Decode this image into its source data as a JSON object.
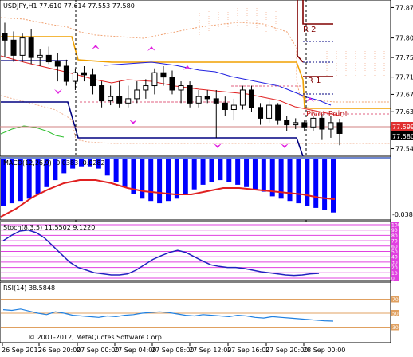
{
  "window": {
    "main_header": "USDJPY,H1  77.610 77.614 77.553 77.580",
    "macd_header": "MACD(12,26,9) -0.0383 -0.0282",
    "stoch_header": "Stoch(8,3,5) 11.5502 9.1220",
    "rsi_header": "RSI(14) 38.5848",
    "copyright": "© 2001-2012, MetaQuotes Software Corp."
  },
  "main_chart": {
    "price_axis": [
      "77.870",
      "77.800",
      "77.755",
      "77.710",
      "77.670",
      "77.630",
      "77.585",
      "77.545"
    ],
    "price_range": [
      77.535,
      77.88
    ],
    "bid_label": "77.599",
    "last_label": "77.580",
    "pivot_labels": [
      "R 2",
      "R 1",
      "Pivot Point"
    ],
    "pivot_levels": {
      "R 2": 77.8,
      "R 1": 77.71,
      "Pivot Point": 77.64
    },
    "candles": [
      {
        "o": 77.81,
        "h": 77.835,
        "l": 77.755,
        "c": 77.795
      },
      {
        "o": 77.795,
        "h": 77.815,
        "l": 77.745,
        "c": 77.76
      },
      {
        "o": 77.76,
        "h": 77.81,
        "l": 77.745,
        "c": 77.8
      },
      {
        "o": 77.8,
        "h": 77.82,
        "l": 77.74,
        "c": 77.755
      },
      {
        "o": 77.755,
        "h": 77.775,
        "l": 77.735,
        "c": 77.76
      },
      {
        "o": 77.76,
        "h": 77.78,
        "l": 77.74,
        "c": 77.745
      },
      {
        "o": 77.745,
        "h": 77.765,
        "l": 77.7,
        "c": 77.735
      },
      {
        "o": 77.735,
        "h": 77.75,
        "l": 77.69,
        "c": 77.7
      },
      {
        "o": 77.7,
        "h": 77.73,
        "l": 77.68,
        "c": 77.72
      },
      {
        "o": 77.72,
        "h": 77.735,
        "l": 77.7,
        "c": 77.715
      },
      {
        "o": 77.715,
        "h": 77.73,
        "l": 77.67,
        "c": 77.69
      },
      {
        "o": 77.69,
        "h": 77.7,
        "l": 77.64,
        "c": 77.655
      },
      {
        "o": 77.655,
        "h": 77.69,
        "l": 77.645,
        "c": 77.665
      },
      {
        "o": 77.665,
        "h": 77.7,
        "l": 77.64,
        "c": 77.65
      },
      {
        "o": 77.65,
        "h": 77.69,
        "l": 77.64,
        "c": 77.66
      },
      {
        "o": 77.66,
        "h": 77.7,
        "l": 77.65,
        "c": 77.68
      },
      {
        "o": 77.68,
        "h": 77.705,
        "l": 77.66,
        "c": 77.69
      },
      {
        "o": 77.69,
        "h": 77.73,
        "l": 77.67,
        "c": 77.72
      },
      {
        "o": 77.72,
        "h": 77.735,
        "l": 77.69,
        "c": 77.71
      },
      {
        "o": 77.71,
        "h": 77.725,
        "l": 77.67,
        "c": 77.68
      },
      {
        "o": 77.68,
        "h": 77.7,
        "l": 77.65,
        "c": 77.69
      },
      {
        "o": 77.69,
        "h": 77.7,
        "l": 77.64,
        "c": 77.65
      },
      {
        "o": 77.65,
        "h": 77.68,
        "l": 77.64,
        "c": 77.665
      },
      {
        "o": 77.665,
        "h": 77.68,
        "l": 77.65,
        "c": 77.66
      },
      {
        "o": 77.66,
        "h": 77.68,
        "l": 77.57,
        "c": 77.65
      },
      {
        "o": 77.65,
        "h": 77.665,
        "l": 77.62,
        "c": 77.635
      },
      {
        "o": 77.635,
        "h": 77.66,
        "l": 77.61,
        "c": 77.645
      },
      {
        "o": 77.645,
        "h": 77.69,
        "l": 77.635,
        "c": 77.68
      },
      {
        "o": 77.68,
        "h": 77.69,
        "l": 77.63,
        "c": 77.64
      },
      {
        "o": 77.64,
        "h": 77.65,
        "l": 77.6,
        "c": 77.615
      },
      {
        "o": 77.615,
        "h": 77.655,
        "l": 77.605,
        "c": 77.645
      },
      {
        "o": 77.645,
        "h": 77.65,
        "l": 77.6,
        "c": 77.61
      },
      {
        "o": 77.61,
        "h": 77.62,
        "l": 77.585,
        "c": 77.6
      },
      {
        "o": 77.6,
        "h": 77.615,
        "l": 77.59,
        "c": 77.605
      },
      {
        "o": 77.605,
        "h": 77.61,
        "l": 77.585,
        "c": 77.595
      },
      {
        "o": 77.595,
        "h": 77.62,
        "l": 77.585,
        "c": 77.615
      },
      {
        "o": 77.615,
        "h": 77.625,
        "l": 77.565,
        "c": 77.59
      },
      {
        "o": 77.59,
        "h": 77.62,
        "l": 77.57,
        "c": 77.605
      },
      {
        "o": 77.605,
        "h": 77.614,
        "l": 77.553,
        "c": 77.58
      }
    ]
  },
  "macd": {
    "axis_labels": [
      "-0.0383"
    ],
    "bars": [
      -0.1,
      -0.095,
      -0.09,
      -0.085,
      -0.075,
      -0.06,
      -0.045,
      -0.03,
      -0.02,
      -0.015,
      -0.015,
      -0.02,
      -0.035,
      -0.05,
      -0.06,
      -0.075,
      -0.085,
      -0.09,
      -0.095,
      -0.09,
      -0.085,
      -0.075,
      -0.065,
      -0.055,
      -0.05,
      -0.045,
      -0.05,
      -0.055,
      -0.06,
      -0.065,
      -0.07,
      -0.08,
      -0.085,
      -0.09,
      -0.095,
      -0.1,
      -0.105,
      -0.11,
      -0.115
    ]
  },
  "stoch": {
    "axis_labels": [
      "100",
      "90",
      "80",
      "70",
      "60",
      "50",
      "40",
      "30",
      "20",
      "10",
      "0"
    ],
    "main_line": [
      70,
      80,
      88,
      90,
      85,
      75,
      60,
      45,
      30,
      20,
      15,
      10,
      8,
      6,
      6,
      8,
      15,
      25,
      35,
      42,
      48,
      52,
      48,
      40,
      32,
      25,
      22,
      20,
      20,
      18,
      15,
      12,
      10,
      8,
      6,
      5,
      6,
      8,
      9
    ]
  },
  "rsi": {
    "axis_labels": [
      "70",
      "50",
      "30"
    ],
    "line": [
      55,
      54,
      56,
      53,
      50,
      48,
      52,
      50,
      47,
      46,
      45,
      44,
      46,
      45,
      47,
      48,
      50,
      51,
      52,
      51,
      49,
      47,
      46,
      48,
      47,
      46,
      45,
      47,
      46,
      44,
      43,
      45,
      44,
      43,
      42,
      41,
      40,
      39,
      38.6
    ]
  },
  "time_axis": [
    "26 Sep 2012",
    "26 Sep 20:00",
    "27 Sep 00:00",
    "27 Sep 04:00",
    "27 Sep 08:00",
    "27 Sep 12:00",
    "27 Sep 16:00",
    "27 Sep 20:00",
    "28 Sep 00:00"
  ]
}
